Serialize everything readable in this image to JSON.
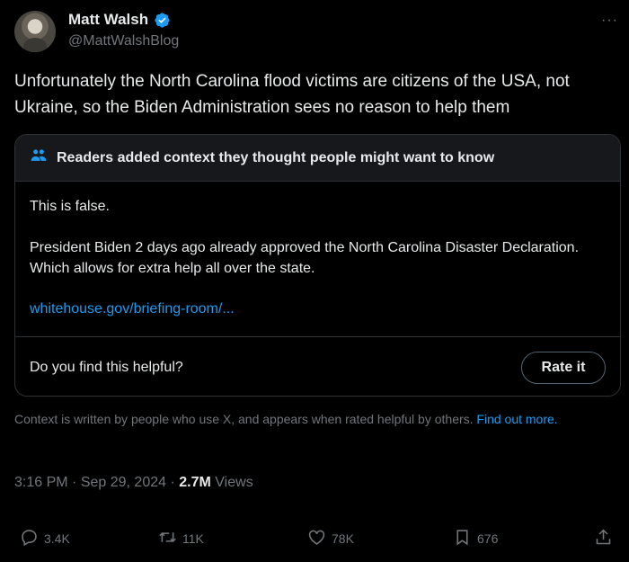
{
  "author": {
    "name": "Matt Walsh",
    "handle": "@MattWalshBlog",
    "verified_color": "#1d9bf0"
  },
  "more_icon": "···",
  "tweet": {
    "text": "Unfortunately the North Carolina flood victims are citizens of the USA, not Ukraine, so the Biden Administration sees no reason to help them"
  },
  "community_note": {
    "title": "Readers added context they thought people might want to know",
    "paragraph1": "This is false.",
    "paragraph2": "President Biden 2 days ago already approved the North Carolina Disaster Declaration. Which allows for extra help all over the state.",
    "link": "whitehouse.gov/briefing-room/...",
    "helpful_question": "Do you find this helpful?",
    "rate_label": "Rate it"
  },
  "disclaimer": {
    "text": "Context is written by people who use X, and appears when rated helpful by others.",
    "link": "Find out more."
  },
  "meta": {
    "time": "3:16 PM",
    "date": "Sep 29, 2024",
    "views_count": "2.7M",
    "views_label": "Views"
  },
  "actions": {
    "replies": "3.4K",
    "retweets": "11K",
    "likes": "78K",
    "bookmarks": "676"
  },
  "colors": {
    "background": "#000000",
    "text": "#e7e9ea",
    "muted": "#71767b",
    "link": "#1d9bf0",
    "border": "#2f3336"
  }
}
